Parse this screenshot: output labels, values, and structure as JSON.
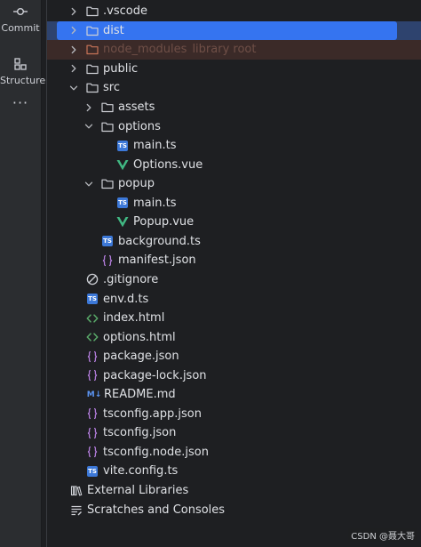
{
  "toolstrip": {
    "commit_label": "Commit",
    "structure_label": "Structure",
    "more_label": "···"
  },
  "tree": [
    {
      "depth": 0,
      "arrow": "right",
      "icon": "folder-icon",
      "name": ".vscode"
    },
    {
      "depth": 0,
      "arrow": "right",
      "icon": "folder-icon",
      "name": "dist",
      "selected": true
    },
    {
      "depth": 0,
      "arrow": "right",
      "icon": "folder-excluded-icon",
      "name": "node_modules",
      "hint": "library root",
      "excluded": true
    },
    {
      "depth": 0,
      "arrow": "right",
      "icon": "folder-icon",
      "name": "public"
    },
    {
      "depth": 0,
      "arrow": "down",
      "icon": "folder-icon",
      "name": "src"
    },
    {
      "depth": 1,
      "arrow": "right",
      "icon": "folder-icon",
      "name": "assets"
    },
    {
      "depth": 1,
      "arrow": "down",
      "icon": "folder-icon",
      "name": "options"
    },
    {
      "depth": 2,
      "arrow": "none",
      "icon": "typescript-icon",
      "name": "main.ts"
    },
    {
      "depth": 2,
      "arrow": "none",
      "icon": "vue-icon",
      "name": "Options.vue"
    },
    {
      "depth": 1,
      "arrow": "down",
      "icon": "folder-icon",
      "name": "popup"
    },
    {
      "depth": 2,
      "arrow": "none",
      "icon": "typescript-icon",
      "name": "main.ts"
    },
    {
      "depth": 2,
      "arrow": "none",
      "icon": "vue-icon",
      "name": "Popup.vue"
    },
    {
      "depth": 1,
      "arrow": "none",
      "icon": "typescript-icon",
      "name": "background.ts"
    },
    {
      "depth": 1,
      "arrow": "none",
      "icon": "json-icon",
      "name": "manifest.json"
    },
    {
      "depth": 0,
      "arrow": "none",
      "icon": "gitignore-icon",
      "name": ".gitignore"
    },
    {
      "depth": 0,
      "arrow": "none",
      "icon": "typescript-icon",
      "name": "env.d.ts"
    },
    {
      "depth": 0,
      "arrow": "none",
      "icon": "html-icon",
      "name": "index.html"
    },
    {
      "depth": 0,
      "arrow": "none",
      "icon": "html-icon",
      "name": "options.html"
    },
    {
      "depth": 0,
      "arrow": "none",
      "icon": "json-icon",
      "name": "package.json"
    },
    {
      "depth": 0,
      "arrow": "none",
      "icon": "json-icon",
      "name": "package-lock.json"
    },
    {
      "depth": 0,
      "arrow": "none",
      "icon": "markdown-icon",
      "name": "README.md"
    },
    {
      "depth": 0,
      "arrow": "none",
      "icon": "json-icon",
      "name": "tsconfig.app.json"
    },
    {
      "depth": 0,
      "arrow": "none",
      "icon": "json-icon",
      "name": "tsconfig.json"
    },
    {
      "depth": 0,
      "arrow": "none",
      "icon": "json-icon",
      "name": "tsconfig.node.json"
    },
    {
      "depth": 0,
      "arrow": "none",
      "icon": "typescript-icon",
      "name": "vite.config.ts"
    },
    {
      "depth": -1,
      "arrow": "none",
      "icon": "external-libraries-icon",
      "name": "External Libraries"
    },
    {
      "depth": -1,
      "arrow": "none",
      "icon": "scratches-icon",
      "name": "Scratches and Consoles"
    }
  ],
  "icon_labels": {
    "typescript": "TS",
    "markdown": "M↓"
  },
  "colors": {
    "selection": "#3574f0",
    "selection_row": "#2e436e",
    "excluded_row": "#3b2a28",
    "vue": "#41b883",
    "json": "#b07bd8",
    "html": "#59a869",
    "typescript": "#3c78d8"
  },
  "watermark": "CSDN @聂大哥"
}
